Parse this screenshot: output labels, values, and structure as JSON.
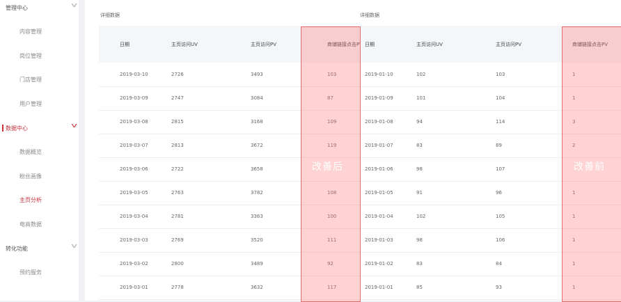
{
  "sidebar": {
    "items": [
      {
        "label": "管理中心",
        "kind": "group",
        "chevron": "chevron-down-icon"
      },
      {
        "label": "内容管理",
        "kind": "sub"
      },
      {
        "label": "岗位管理",
        "kind": "sub"
      },
      {
        "label": "门店管理",
        "kind": "sub"
      },
      {
        "label": "用户管理",
        "kind": "sub"
      },
      {
        "label": "数据中心",
        "kind": "group",
        "active": true,
        "chevron": "chevron-down-icon"
      },
      {
        "label": "数据概览",
        "kind": "sub"
      },
      {
        "label": "粉丝画像",
        "kind": "sub"
      },
      {
        "label": "主页分析",
        "kind": "sub",
        "active": true
      },
      {
        "label": "电商数据",
        "kind": "sub"
      },
      {
        "label": "转化功能",
        "kind": "group",
        "chevron": "chevron-down-icon"
      },
      {
        "label": "预约服务",
        "kind": "sub"
      }
    ]
  },
  "colors": {
    "accent": "#c7303b",
    "highlight": "#f8b9b9"
  },
  "tables": {
    "left": {
      "title": "详细数据",
      "headers": [
        "日期",
        "主页访问UV",
        "主页访问PV",
        "商铺链接点击PV"
      ],
      "rows": [
        [
          "2019-03-10",
          "2726",
          "3493",
          "103"
        ],
        [
          "2019-03-09",
          "2747",
          "3084",
          "87"
        ],
        [
          "2019-03-08",
          "2815",
          "3168",
          "109"
        ],
        [
          "2019-03-07",
          "2813",
          "3672",
          "119"
        ],
        [
          "2019-03-06",
          "2722",
          "3658",
          ""
        ],
        [
          "2019-03-05",
          "2763",
          "3782",
          "108"
        ],
        [
          "2019-03-04",
          "2781",
          "3363",
          "100"
        ],
        [
          "2019-03-03",
          "2769",
          "3520",
          "111"
        ],
        [
          "2019-03-02",
          "2800",
          "3489",
          "92"
        ],
        [
          "2019-03-01",
          "2778",
          "3632",
          "117"
        ]
      ],
      "highlight_label": "改善后"
    },
    "right": {
      "title": "详细数据",
      "headers": [
        "日期",
        "主页访问UV",
        "主页访问PV",
        "商铺链接点击PV"
      ],
      "rows": [
        [
          "2019-01-10",
          "102",
          "103",
          "1"
        ],
        [
          "2019-01-09",
          "101",
          "104",
          "1"
        ],
        [
          "2019-01-08",
          "94",
          "114",
          "3"
        ],
        [
          "2019-01-07",
          "83",
          "89",
          "2"
        ],
        [
          "2019-01-06",
          "98",
          "107",
          ""
        ],
        [
          "2019-01-05",
          "91",
          "96",
          "1"
        ],
        [
          "2019-01-04",
          "102",
          "105",
          "1"
        ],
        [
          "2019-01-03",
          "98",
          "106",
          "1"
        ],
        [
          "2019-01-02",
          "83",
          "84",
          "1"
        ],
        [
          "2019-01-01",
          "85",
          "93",
          "1"
        ]
      ],
      "highlight_label": "改善前"
    }
  }
}
